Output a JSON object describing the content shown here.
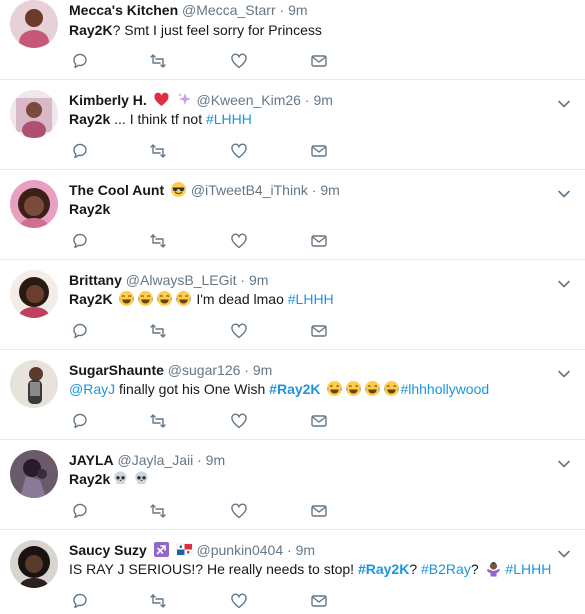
{
  "tweets": [
    {
      "name": "Mecca's Kitchen",
      "handle": "@Mecca_Starr",
      "time": "9m",
      "text_bold": "Ray2K",
      "text_rest": "? Smt I just feel sorry for Princess",
      "avatar_color": "#c8587a",
      "name_emojis": []
    },
    {
      "name": "Kimberly H.",
      "handle": "@Kween_Kim26",
      "time": "9m",
      "text_bold": "Ray2k",
      "text_rest": " ... I think tf not ",
      "hashtag": "#LHHH",
      "avatar_color": "#d9b8c8",
      "name_emojis": [
        "heart-emoji",
        "sparkles-emoji"
      ]
    },
    {
      "name": "The Cool Aunt",
      "handle": "@iTweetB4_iThink",
      "time": "9m",
      "text_bold": "Ray2k",
      "avatar_color": "#7a4a3a",
      "name_emojis": [
        "sunglasses-emoji"
      ]
    },
    {
      "name": "Brittany",
      "handle": "@AlwaysB_LEGit",
      "time": "9m",
      "text_bold": "Ray2K",
      "text_rest": " I'm dead lmao ",
      "hashtag": "#LHHH",
      "text_emojis": [
        "joy-emoji",
        "joy-emoji",
        "joy-emoji",
        "joy-emoji"
      ],
      "avatar_color": "#3a2420",
      "name_emojis": []
    },
    {
      "name": "SugarShaunte",
      "handle": "@sugar126",
      "time": "9m",
      "mention": "@RayJ",
      "text_mid": " finally got his One Wish ",
      "hashtag_bold": "#Ray2K",
      "hashtag_end": "#lhhhollywood",
      "text_emojis": [
        "joy-emoji",
        "joy-emoji",
        "joy-emoji",
        "joy-emoji"
      ],
      "avatar_color": "#d8d0c8",
      "name_emojis": []
    },
    {
      "name": "JAYLA",
      "handle": "@Jayla_Jaii",
      "time": "9m",
      "text_bold": "Ray2k",
      "text_emojis": [
        "skull-emoji",
        "skull-emoji"
      ],
      "avatar_color": "#5a3a5a",
      "name_emojis": []
    },
    {
      "name": "Saucy Suzy",
      "handle": "@punkin0404",
      "time": "9m",
      "text_start": "IS RAY J SERIOUS!? He really needs to stop! ",
      "hashtag_bold": "#Ray2K",
      "text_mid": "? ",
      "hashtag_2": "#B2Ray",
      "text_mid2": "? ",
      "hashtag_end": "#LHHH",
      "avatar_color": "#2a1a1a",
      "name_emojis": [
        "sagittarius-emoji",
        "panama-flag-emoji"
      ],
      "text_emojis": [
        "person-shrugging-emoji"
      ]
    }
  ],
  "separator": "·",
  "colors": {
    "name": "#14171a",
    "meta": "#657786",
    "link": "#1b95e0",
    "border": "#e6ecf0",
    "icon": "#657786"
  }
}
